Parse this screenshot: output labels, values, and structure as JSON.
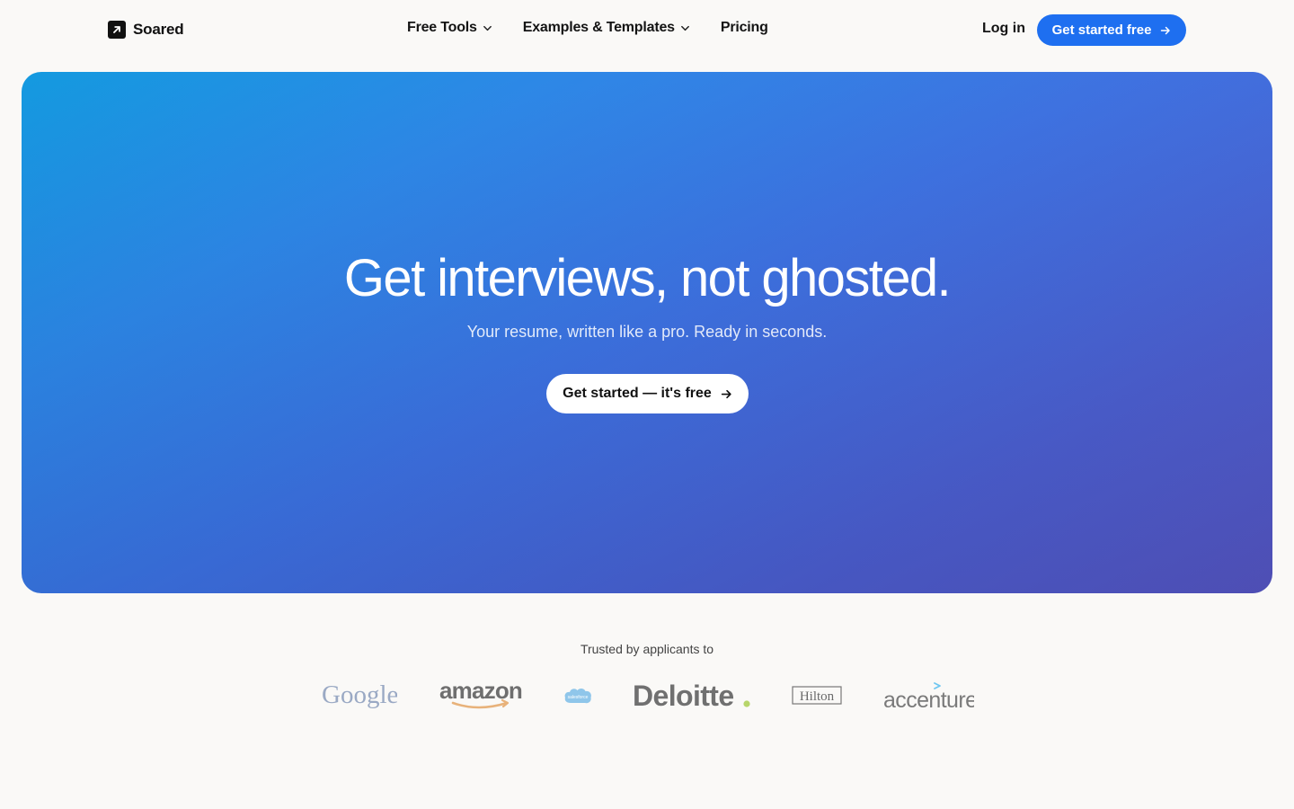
{
  "nav": {
    "brand": "Soared",
    "menu": [
      {
        "label": "Free Tools",
        "dropdown": true
      },
      {
        "label": "Examples & Templates",
        "dropdown": true
      },
      {
        "label": "Pricing",
        "dropdown": false
      }
    ],
    "login": "Log in",
    "cta": "Get started free"
  },
  "hero": {
    "title": "Get interviews, not ghosted.",
    "subtitle": "Your resume, written like a pro. Ready in seconds.",
    "cta": "Get started — it's free"
  },
  "trusted": {
    "label": "Trusted by applicants to",
    "logos": [
      "Google",
      "amazon",
      "salesforce",
      "Deloitte",
      "Hilton",
      "accenture"
    ]
  },
  "colors": {
    "accent": "#1e6ff0",
    "hero_start": "#0f98df",
    "hero_end": "#5353bf",
    "background": "#faf9f7"
  },
  "icons": {
    "brand": "arrow-up-right-icon",
    "dropdown": "chevron-down-icon",
    "cta": "arrow-right-icon"
  }
}
